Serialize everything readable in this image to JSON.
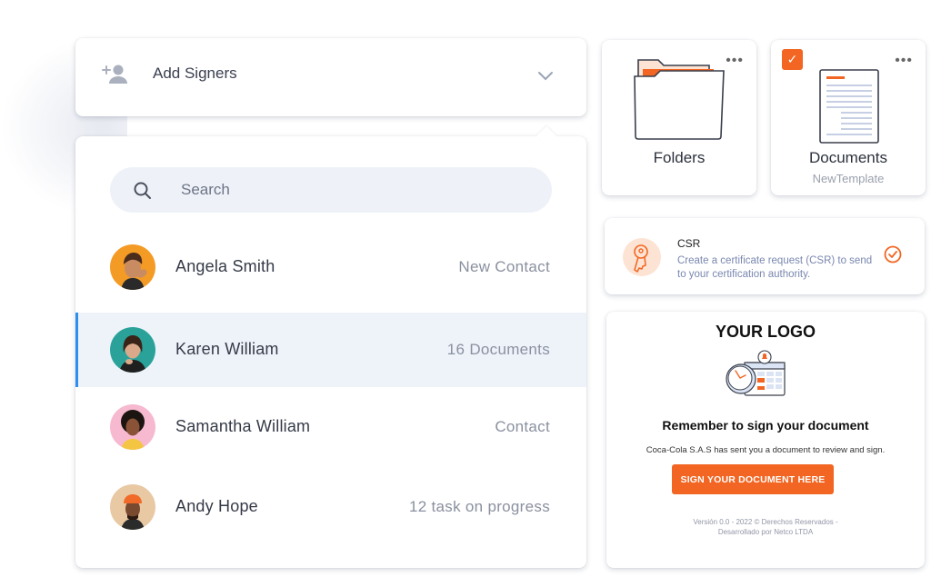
{
  "signers": {
    "header_label": "Add Signers",
    "search_placeholder": "Search",
    "contacts": [
      {
        "name": "Angela Smith",
        "meta": "New Contact",
        "avatar_color": "#f49b26"
      },
      {
        "name": "Karen William",
        "meta": "16 Documents",
        "avatar_color": "#2aa29a"
      },
      {
        "name": "Samantha William",
        "meta": "Contact",
        "avatar_color": "#f6b9cf"
      },
      {
        "name": "Andy Hope",
        "meta": "12 task on progress",
        "avatar_color": "#e8c9a3"
      }
    ],
    "active_index": 1
  },
  "tiles": {
    "folders_label": "Folders",
    "documents_label": "Documents",
    "documents_sub": "NewTemplate",
    "more_glyph": "•••"
  },
  "csr": {
    "title": "CSR",
    "description": "Create a certificate request (CSR) to send to your certification authority."
  },
  "email": {
    "logo_text": "YOUR LOGO",
    "heading": "Remember to sign your document",
    "message": "Coca-Cola S.A.S has sent you a document to review and sign.",
    "button_label": "SIGN YOUR DOCUMENT HERE",
    "footer_line1": "Versión 0.0 - 2022 © Derechos Reservados -",
    "footer_line2": "Desarrollado por Netco LTDA"
  },
  "colors": {
    "accent": "#f26522",
    "active_border": "#2e8ff0",
    "active_row_bg": "#eef3fa"
  }
}
